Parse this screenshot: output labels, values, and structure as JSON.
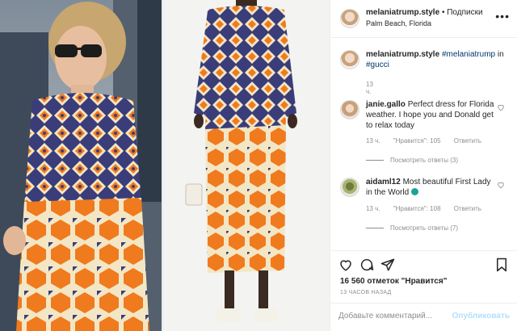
{
  "post": {
    "username": "melaniatrump.style",
    "follow_label": "Подписки",
    "location": "Palm Beach, Florida",
    "more_icon": "more-icon"
  },
  "caption": {
    "username": "melaniatrump.style",
    "hashtag": "#melaniatrump",
    "in_text": "in",
    "brand_tag": "#gucci",
    "time": "13 ч."
  },
  "comments": [
    {
      "username": "janie.gallo",
      "text": "Perfect dress for Florida weather. I hope you and Donald get to relax today",
      "time": "13 ч.",
      "likes": "\"Нравится\": 105",
      "reply": "Ответить",
      "view_replies": "Посмотреть ответы (3)"
    },
    {
      "username": "aidaml12",
      "text": "Most beautiful First Lady in the World",
      "emoji": "green-circle",
      "time": "13 ч.",
      "likes": "\"Нравится\": 108",
      "reply": "Ответить",
      "view_replies": "Посмотреть ответы (7)"
    }
  ],
  "actions": {
    "likes_text": "16 560 отметок \"Нравится\"",
    "posted": "13 ЧАСОВ НАЗАД",
    "comment_placeholder": "Добавьте комментарий...",
    "publish_label": "Опубликовать"
  },
  "colors": {
    "dress_navy": "#3a3d7a",
    "dress_orange": "#f07a1e",
    "dress_cream": "#f3e6c4",
    "link": "#00376b",
    "publish_disabled": "#b2dffc"
  }
}
